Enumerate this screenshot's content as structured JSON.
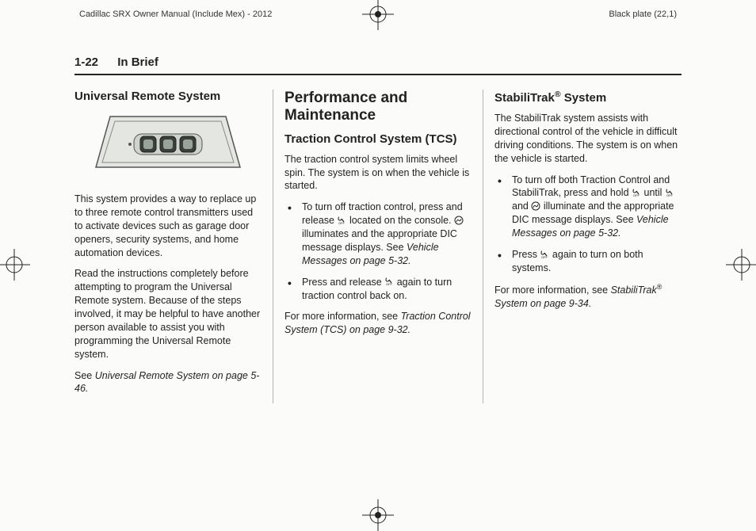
{
  "header": {
    "left": "Cadillac SRX Owner Manual (Include Mex) - 2012",
    "right": "Black plate (22,1)"
  },
  "page_head": {
    "number": "1-22",
    "title": "In Brief"
  },
  "col1": {
    "h1": "Universal Remote System",
    "p1": "This system provides a way to replace up to three remote control transmitters used to activate devices such as garage door openers, security systems, and home automation devices.",
    "p2": "Read the instructions completely before attempting to program the Universal Remote system. Because of the steps involved, it may be helpful to have another person available to assist you with programming the Universal Remote system.",
    "see_prefix": "See ",
    "see_link": "Universal Remote System on page 5-46."
  },
  "col2": {
    "h1": "Performance and Maintenance",
    "h2": "Traction Control System (TCS)",
    "p1": "The traction control system limits wheel spin. The system is on when the vehicle is started.",
    "li1a": "To turn off traction control, press and release ",
    "li1b": " located on the console. ",
    "li1c": " illuminates and the appropriate DIC message displays. See ",
    "li1link": "Vehicle Messages on page 5-32.",
    "li2a": "Press and release ",
    "li2b": " again to turn traction control back on.",
    "more_prefix": "For more information, see ",
    "more_link": "Traction Control System (TCS) on page 9-32."
  },
  "col3": {
    "h1a": "StabiliTrak",
    "h1b": " System",
    "p1": "The StabiliTrak system assists with directional control of the vehicle in difficult driving conditions. The system is on when the vehicle is started.",
    "li1a": "To turn off both Traction Control and StabiliTrak, press and hold ",
    "li1b": " until ",
    "li1c": " and ",
    "li1d": " illuminate and the appropriate DIC message displays. See ",
    "li1link": "Vehicle Messages on page 5-32.",
    "li2a": "Press ",
    "li2b": " again to turn on both systems.",
    "more_prefix": "For more information, see ",
    "more_link_a": "StabiliTrak",
    "more_link_b": " System on page 9-34."
  }
}
